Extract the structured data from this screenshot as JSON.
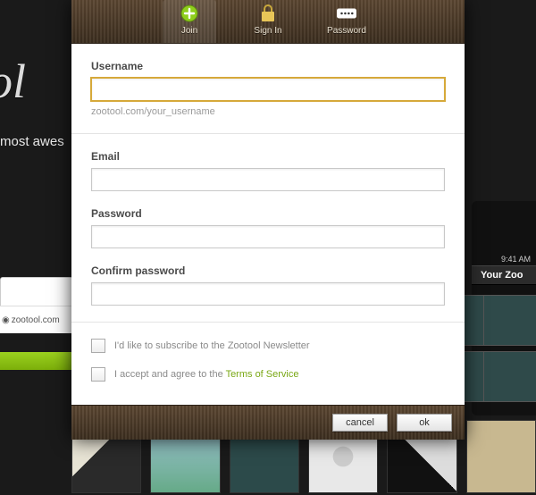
{
  "bg": {
    "logo_fragment": "ool",
    "tagline_fragment": "most awes",
    "address": "zootool.com",
    "device_time": "9:41 AM",
    "device_title": "Your Zoo"
  },
  "tabs": {
    "join": "Join",
    "signin": "Sign In",
    "password": "Password"
  },
  "form": {
    "username_label": "Username",
    "username_value": "",
    "username_hint": "zootool.com/your_username",
    "email_label": "Email",
    "email_value": "",
    "password_label": "Password",
    "password_value": "",
    "confirm_label": "Confirm password",
    "confirm_value": "",
    "newsletter_label": "I'd like to subscribe to the Zootool Newsletter",
    "accept_prefix": "I accept and agree to the ",
    "tos_link": "Terms of Service"
  },
  "buttons": {
    "cancel": "cancel",
    "ok": "ok"
  }
}
